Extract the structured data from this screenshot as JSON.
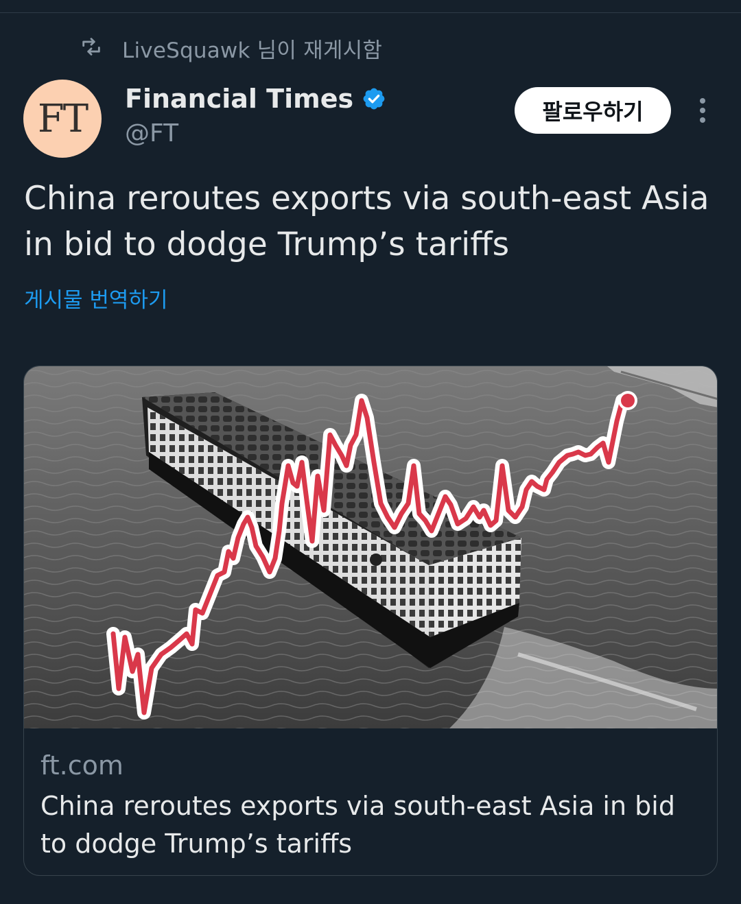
{
  "repost": {
    "text": "LiveSquawk 님이 재게시함",
    "icon": "repost-icon"
  },
  "author": {
    "avatar_text": "FT",
    "name": "Financial Times",
    "handle": "@FT",
    "verified": true,
    "verified_icon": "verified-badge-icon"
  },
  "actions": {
    "follow_label": "팔로우하기",
    "more_icon": "more-vertical-icon"
  },
  "tweet": {
    "text": "China reroutes exports via south-east Asia in bid to dodge Trump’s tariffs",
    "translate_label": "게시물 번역하기"
  },
  "card": {
    "domain": "ft.com",
    "title": "China reroutes exports via south-east Asia in bid to dodge Trump’s tariffs"
  },
  "colors": {
    "background": "#15202b",
    "link": "#1d9bf0",
    "secondary_text": "#8b98a5",
    "avatar_bg": "#fcd0b1",
    "chart_line": "#d9384a"
  }
}
